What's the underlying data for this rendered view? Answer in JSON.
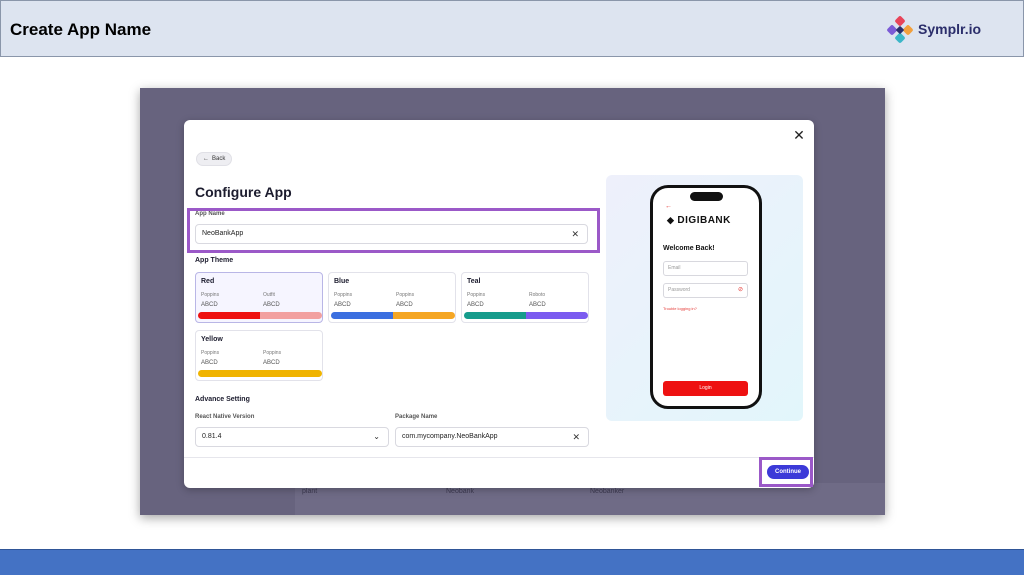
{
  "slide": {
    "title": "Create App Name",
    "brand_name": "Symplr.io",
    "brand_icon": "symplr-logo-icon"
  },
  "background_app": {
    "cells": [
      "plant",
      "Neobank",
      "Neobanker"
    ]
  },
  "modal": {
    "close_icon": "close-icon",
    "back_label": "Back",
    "back_icon": "arrow-left-icon",
    "title": "Configure App",
    "app_name": {
      "label": "App Name",
      "value": "NeoBankApp",
      "clear_icon": "clear-icon"
    },
    "app_theme": {
      "heading": "App Theme",
      "themes": [
        {
          "name": "Red",
          "font1": "Poppins",
          "font2": "Outfit",
          "sample1": "ABCD",
          "sample2": "ABCD",
          "color1": "#ee1111",
          "color2": "#f2a0a0",
          "selected": true
        },
        {
          "name": "Blue",
          "font1": "Poppins",
          "font2": "Poppins",
          "sample1": "ABCD",
          "sample2": "ABCD",
          "color1": "#3b6fe0",
          "color2": "#f5a623",
          "selected": false
        },
        {
          "name": "Teal",
          "font1": "Poppins",
          "font2": "Roboto",
          "sample1": "ABCD",
          "sample2": "ABCD",
          "color1": "#169c8c",
          "color2": "#7b5bf0",
          "selected": false
        },
        {
          "name": "Yellow",
          "font1": "Poppins",
          "font2": "Poppins",
          "sample1": "ABCD",
          "sample2": "ABCD",
          "color1": "#f0b400",
          "color2": "#f0b400",
          "selected": false
        }
      ]
    },
    "advance": {
      "heading": "Advance Setting",
      "rn_label": "React Native Version",
      "rn_value": "0.81.4",
      "pkg_label": "Package Name",
      "pkg_value": "com.mycompany.NeoBankApp"
    },
    "continue_label": "Continue",
    "preview": {
      "back_arrow": "←",
      "logo_text": "DIGIBANK",
      "welcome": "Welcome Back!",
      "email_placeholder": "Email",
      "password_placeholder": "Password",
      "forgot": "Trouble logging in?",
      "login_label": "Login"
    }
  },
  "colors": {
    "highlight": "#9b59c8",
    "accent": "#3c3ad8",
    "footer": "#4472c4"
  }
}
